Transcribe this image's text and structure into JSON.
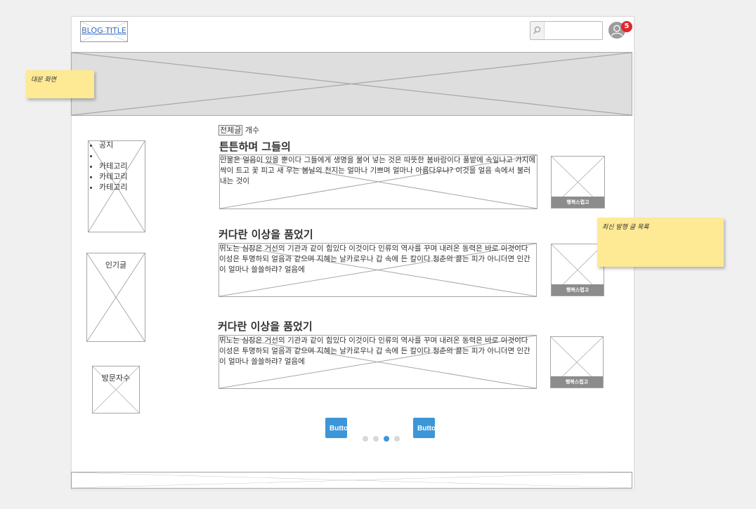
{
  "header": {
    "logo_text": "BLOG TITLE",
    "search_placeholder": "",
    "notification_count": "5"
  },
  "notes": {
    "hero": "대문 화면",
    "recent": "최신 발행 글 목록"
  },
  "sidebar": {
    "categories": [
      "공지",
      "",
      "카테고리",
      "카테고리",
      "카테고리"
    ],
    "popular": "인기글",
    "visitors": "방문자수"
  },
  "posts_header": {
    "all_label": "전체글",
    "count_label": "개수"
  },
  "posts": [
    {
      "title": "튼튼하며 그들의",
      "excerpt": "만물은 얼음이 있을 뿐이다 그들에게 생명을 불어 넣는 것은 따뜻한 봄바람이다 풀밭에 속잎나고 가지에 싹이 트고 꽃 피고 새 우는 봄날의 천지는 얼마나 기쁘며 얼마나 아름다우냐? 이것을 얼음 속에서 불러 내는 것이",
      "thumb_caption": "행복스럽고"
    },
    {
      "title": "커다란 이상을 품었기",
      "excerpt": "뛰노는 심장은 거선의 기관과 같이 힘있다 이것이다 인류의 역사를 꾸며 내려온 동력은 바로 이것이다 이성은 투명하되 얼음과 같으며 지혜는 날카로우나 갑 속에 든 칼이다 청춘의 끓는 피가 아니더면 인간이 얼마나 쓸쓸하랴? 얼음에",
      "thumb_caption": "행복스럽고"
    },
    {
      "title": "커다란 이상을 품었기",
      "excerpt": "뛰노는 심장은 거선의 기관과 같이 힘있다 이것이다 인류의 역사를 꾸며 내려온 동력은 바로 이것이다 이성은 투명하되 얼음과 같으며 지혜는 날카로우나 갑 속에 든 칼이다 청춘의 끓는 피가 아니더면 인간이 얼마나 쓸쓸하랴? 얼음에",
      "thumb_caption": "행복스럽고"
    }
  ],
  "pager": {
    "prev_label": "Button",
    "next_label": "Button",
    "page_count": 4,
    "active_page": 3
  },
  "colors": {
    "accent": "#3d96d8",
    "badge": "#e0262b",
    "sticky": "#fee994"
  }
}
